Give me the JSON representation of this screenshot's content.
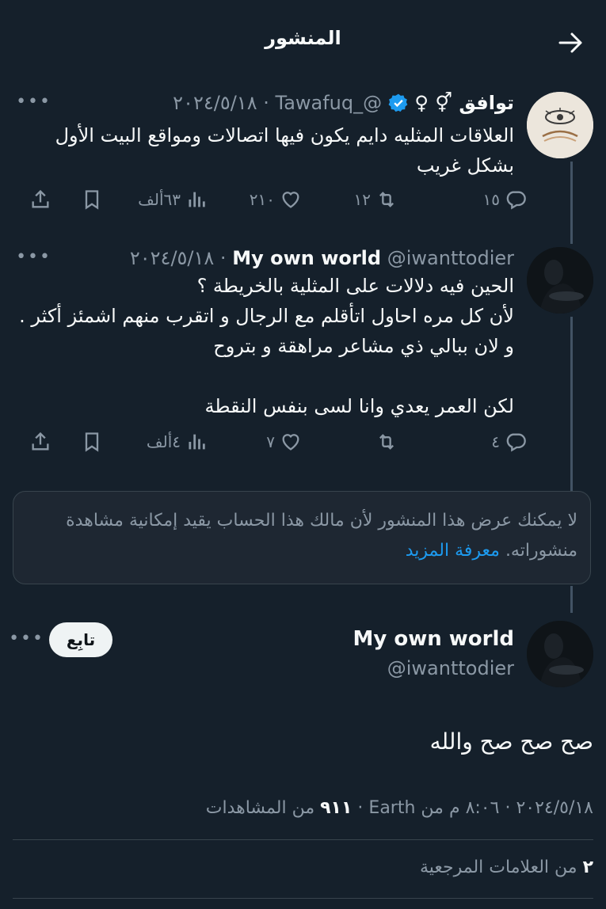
{
  "header": {
    "title": "المنشور",
    "back_icon": "arrow-right-icon"
  },
  "tweets": [
    {
      "display_name": "توافق ⚥ ♀",
      "verified": true,
      "handle": "@_Tawafuq",
      "date": "٢٠٢٤/٥/١٨",
      "text": "العلاقات المثليه دايم يكون فيها اتصالات ومواقع البيت الأول بشكل غريب",
      "replies": "١٥",
      "reposts": "١٢",
      "likes": "٢١٠",
      "views": "٦٣ألف"
    },
    {
      "display_name": "My own world",
      "handle": "@iwanttodier",
      "date": "٢٠٢٤/٥/١٨",
      "text": "الحين فيه دلالات على المثلية بالخريطة ؟\nلأن كل مره احاول اتأقلم مع الرجال و اتقرب منهم اشمئز أكثر . و لان ببالي ذي مشاعر مراهقة و بتروح\n\nلكن العمر يعدي وانا لسى بنفس النقطة",
      "replies": "٤",
      "reposts": "",
      "likes": "٧",
      "views": "٤ألف"
    }
  ],
  "notice": {
    "text": "لا يمكنك عرض هذا المنشور لأن مالك هذا الحساب يقيد إمكانية مشاهدة منشوراته.",
    "link": "معرفة المزيد"
  },
  "main_post": {
    "display_name": "My own world",
    "handle": "@iwanttodier",
    "follow_label": "تابِع",
    "text": "صح صح صح والله",
    "date": "٢٠٢٤/٥/١٨",
    "time": "٨:٠٦ م",
    "source": "من Earth",
    "views_count": "٩١١",
    "views_label": "من المشاهدات",
    "bookmarks_count": "٢",
    "bookmarks_label": "من العلامات المرجعية"
  },
  "colors": {
    "background": "#15202b",
    "text": "#f7f9f9",
    "muted": "#8b98a5",
    "accent": "#1d9bf0"
  }
}
